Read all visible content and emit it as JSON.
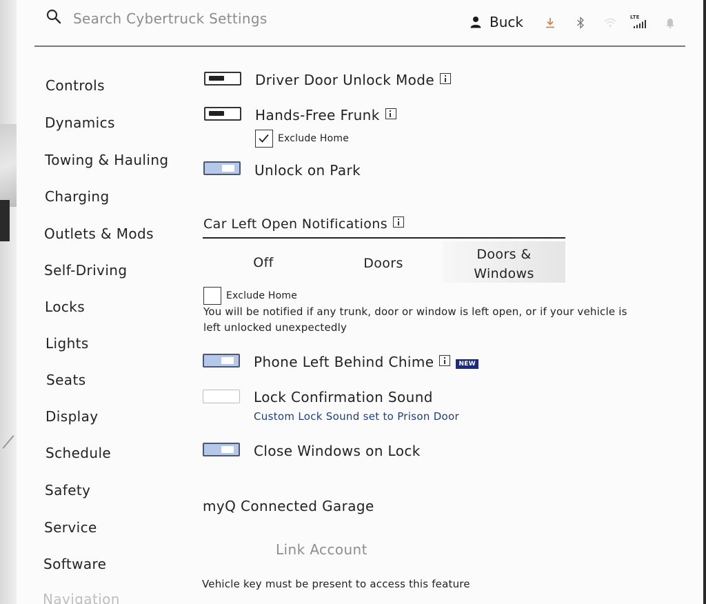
{
  "header": {
    "search_placeholder": "Search Cybertruck Settings",
    "user_name": "Buck",
    "status_icons": [
      "download-icon",
      "bluetooth-icon",
      "wifi-icon",
      "lte-signal-icon",
      "bell-icon"
    ],
    "lte_label": "LTE"
  },
  "sidebar": {
    "items": [
      {
        "label": "Controls"
      },
      {
        "label": "Dynamics"
      },
      {
        "label": "Towing & Hauling"
      },
      {
        "label": "Charging"
      },
      {
        "label": "Outlets & Mods"
      },
      {
        "label": "Self-Driving"
      },
      {
        "label": "Locks"
      },
      {
        "label": "Lights"
      },
      {
        "label": "Seats"
      },
      {
        "label": "Display"
      },
      {
        "label": "Schedule"
      },
      {
        "label": "Safety"
      },
      {
        "label": "Service"
      },
      {
        "label": "Software"
      },
      {
        "label": "Navigation"
      }
    ]
  },
  "locks": {
    "driver_door_unlock_mode": {
      "label": "Driver Door Unlock Mode",
      "enabled": false
    },
    "hands_free_frunk": {
      "label": "Hands-Free Frunk",
      "enabled": false,
      "exclude_home_label": "Exclude Home",
      "exclude_home_checked": true
    },
    "unlock_on_park": {
      "label": "Unlock on Park",
      "enabled": true
    },
    "car_left_open": {
      "title": "Car Left Open Notifications",
      "options": [
        "Off",
        "Doors",
        "Doors & Windows"
      ],
      "selected": "Doors & Windows",
      "exclude_home_label": "Exclude Home",
      "exclude_home_checked": false,
      "description": "You will be notified if any trunk, door or window is left open, or if your vehicle is left unlocked unexpectedly"
    },
    "phone_left_behind_chime": {
      "label": "Phone Left Behind Chime",
      "badge": "NEW",
      "enabled": true
    },
    "lock_confirmation_sound": {
      "label": "Lock Confirmation Sound",
      "enabled": false,
      "sub_label": "Custom Lock Sound set to Prison Door"
    },
    "close_windows_on_lock": {
      "label": "Close Windows on Lock",
      "enabled": true
    },
    "myq": {
      "title": "myQ Connected Garage",
      "link_label": "Link Account",
      "note": "Vehicle key must be present to access this feature"
    }
  }
}
